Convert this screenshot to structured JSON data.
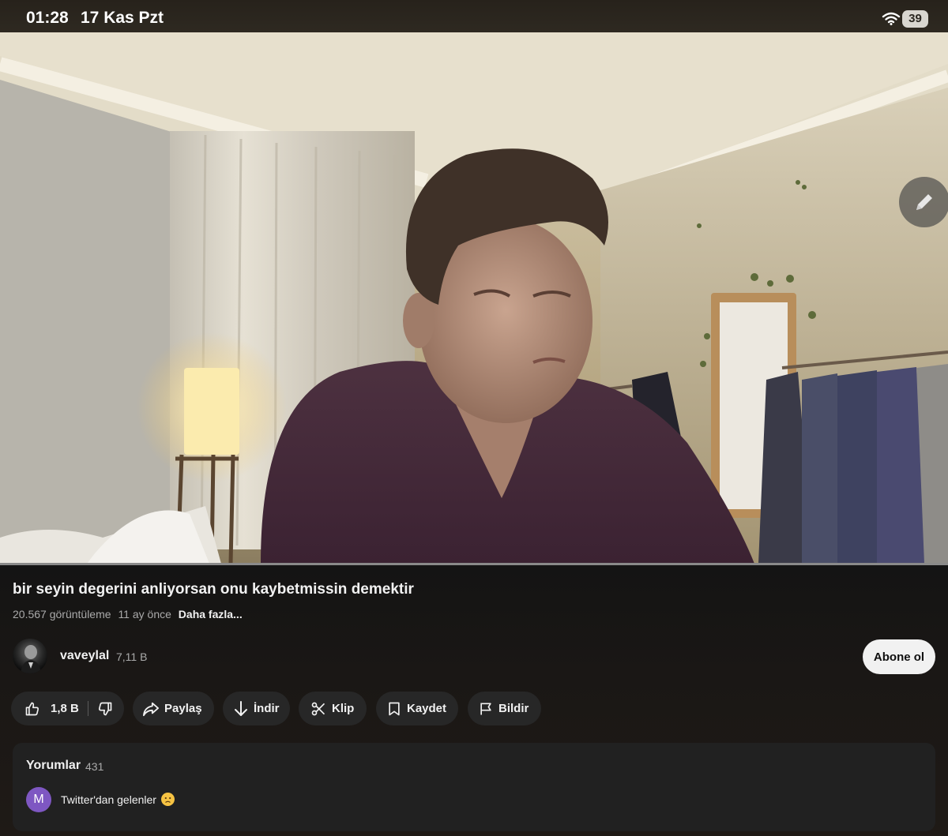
{
  "status_bar": {
    "time": "01:28",
    "date": "17 Kas Pzt",
    "battery": "39"
  },
  "video": {
    "title": "bir seyin degerini anliyorsan onu kaybetmissin demektir",
    "views": "20.567 görüntüleme",
    "age": "11 ay önce",
    "more_label": "Daha fazla..."
  },
  "channel": {
    "name": "vaveylal",
    "subscribers": "7,11 B",
    "subscribe_label": "Abone ol"
  },
  "actions": {
    "like_count": "1,8 B",
    "share_label": "Paylaş",
    "download_label": "İndir",
    "clip_label": "Klip",
    "save_label": "Kaydet",
    "report_label": "Bildir"
  },
  "comments": {
    "title": "Yorumlar",
    "count": "431",
    "top_comment": {
      "avatar_letter": "M",
      "text": "Twitter'dan gelenler"
    }
  },
  "colors": {
    "background": "#0f0f0f",
    "pill": "#272727",
    "subscribe_bg": "#f1f1f1",
    "comment_avatar": "#7e57c2"
  },
  "icons": [
    "wifi-icon",
    "pencil-icon",
    "thumbs-up-icon",
    "thumbs-down-icon",
    "share-icon",
    "download-icon",
    "scissors-icon",
    "bookmark-icon",
    "flag-icon"
  ]
}
